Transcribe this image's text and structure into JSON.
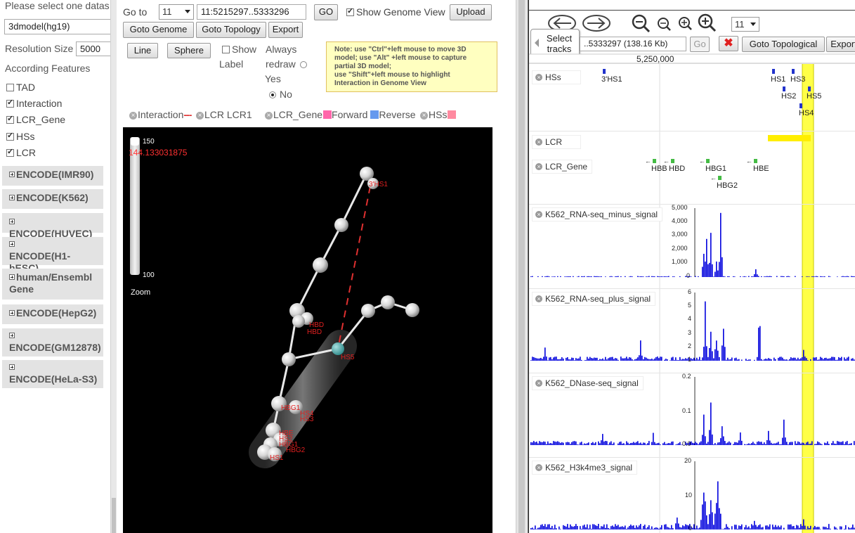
{
  "left_panel": {
    "select_prompt": "Please select one datas",
    "dataset_value": "3dmodel(hg19)",
    "resolution_label": "Resolution Size",
    "resolution_value": "5000",
    "features_heading": "According Features",
    "features": [
      {
        "label": "TAD",
        "checked": false
      },
      {
        "label": "Interaction",
        "checked": true
      },
      {
        "label": "LCR_Gene",
        "checked": true
      },
      {
        "label": "HSs",
        "checked": true
      },
      {
        "label": "LCR",
        "checked": true
      }
    ],
    "encode_groups": [
      "ENCODE(IMR90)",
      "ENCODE(K562)",
      "ENCODE(HUVEC)",
      "ENCODE(H1-hESC)",
      "human/Ensembl Gene",
      "ENCODE(HepG2)",
      "ENCODE(GM12878)",
      "ENCODE(HeLa-S3)"
    ]
  },
  "toolbar": {
    "goto_label": "Go to",
    "chrom_value": "11",
    "range_value": "11:5215297..5333296",
    "go_label": "GO",
    "show_genome_label": "Show Genome View",
    "upload_label": "Upload",
    "goto_genome_label": "Goto Genome",
    "goto_topology_label": "Goto Topology",
    "export_label": "Export"
  },
  "view_controls": {
    "line_label": "Line",
    "sphere_label": "Sphere",
    "show_label_1": "Show",
    "show_label_2": "Label",
    "always_label": "Always",
    "redraw_label": "redraw",
    "yes_label": "Yes",
    "no_label": "No"
  },
  "note_lines": [
    "Note: use \"Ctrl\"+left mouse to move 3D",
    "model;  use \"Alt\" +left mouse to capture",
    "partial 3D model;",
    "use \"Shift\"+left mouse to highlight",
    "Interaction in Genome View"
  ],
  "legend": {
    "interaction": "Interaction",
    "lcr": "LCR LCR1",
    "lcr_gene": "LCR_Gene",
    "forward": "Forward",
    "reverse": "Reverse",
    "hss": "HSs",
    "colors": {
      "interaction": "#e03030",
      "forward": "#ff66aa",
      "reverse": "#6699ee",
      "hss": "#ff8aa0"
    }
  },
  "viewer3d": {
    "slider_max": "150",
    "slider_min": "100",
    "slider_value": "144.133031875",
    "zoom_label": "Zoom",
    "node_labels": {
      "hs1_3": "3'HS1",
      "hbd_a": "HBD",
      "hbd_b": "HBD",
      "hs5": "HS5",
      "hbg1": "HBG1",
      "hs4": "HS4",
      "hs3": "HS3",
      "hbe": "HBE",
      "hs2": "HS2",
      "hbg1_b": "HBG1",
      "hbg2": "HBG2",
      "hs1": "HS1"
    }
  },
  "genome_view": {
    "chrom_value": "11",
    "location_value": "..5333297 (138.16 Kb)",
    "go_label": "Go",
    "goto_topological_label": "Goto Topological",
    "export_label": "Export",
    "select_tracks_1": "Select",
    "select_tracks_2": "tracks",
    "ruler_label": "5,250,000",
    "highlight_color": "#ffff33",
    "tracks": [
      {
        "name": "HSs"
      },
      {
        "name": "LCR"
      },
      {
        "name": "LCR_Gene"
      },
      {
        "name": "K562_RNA-seq_minus_signal",
        "ticks": [
          "5,000",
          "4,000",
          "3,000",
          "2,000",
          "1,000",
          "0"
        ]
      },
      {
        "name": "K562_RNA-seq_plus_signal",
        "ticks": [
          "6",
          "5",
          "4",
          "3",
          "2",
          "1"
        ]
      },
      {
        "name": "K562_DNase-seq_signal",
        "ticks": [
          "0.2",
          "0.1",
          "0.0"
        ]
      },
      {
        "name": "K562_H3k4me3_signal",
        "ticks": [
          "20",
          "10",
          "0"
        ]
      }
    ],
    "features": {
      "hs1_3": "3'HS1",
      "hs1": "HS1",
      "hs3": "HS3",
      "hs2": "HS2",
      "hs5": "HS5",
      "hs4": "HS4",
      "hbb": "HBB",
      "hbd": "HBD",
      "hbg1": "HBG1",
      "hbe": "HBE",
      "hbg2": "HBG2"
    }
  }
}
